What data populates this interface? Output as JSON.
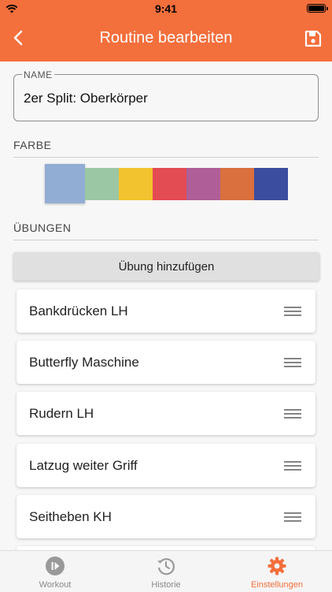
{
  "status": {
    "time": "9:41"
  },
  "header": {
    "title": "Routine bearbeiten"
  },
  "name_field": {
    "label": "NAME",
    "value": "2er Split: Oberkörper"
  },
  "color_section": {
    "label": "FARBE",
    "selected_index": 0,
    "swatches": [
      "#92add4",
      "#9cc7a4",
      "#f3c32f",
      "#e34c52",
      "#b05e98",
      "#d9703e",
      "#3a4d9f"
    ]
  },
  "exercises_section": {
    "label": "ÜBUNGEN",
    "add_label": "Übung hinzufügen",
    "items": [
      "Bankdrücken LH",
      "Butterfly Maschine",
      "Rudern LH",
      "Latzug weiter Griff",
      "Seitheben KH"
    ]
  },
  "bottom_nav": {
    "items": [
      {
        "label": "Workout",
        "icon": "play-circle-icon"
      },
      {
        "label": "Historie",
        "icon": "history-icon"
      },
      {
        "label": "Einstellungen",
        "icon": "gear-icon",
        "active": true
      }
    ]
  },
  "colors": {
    "accent": "#f36f3c"
  }
}
